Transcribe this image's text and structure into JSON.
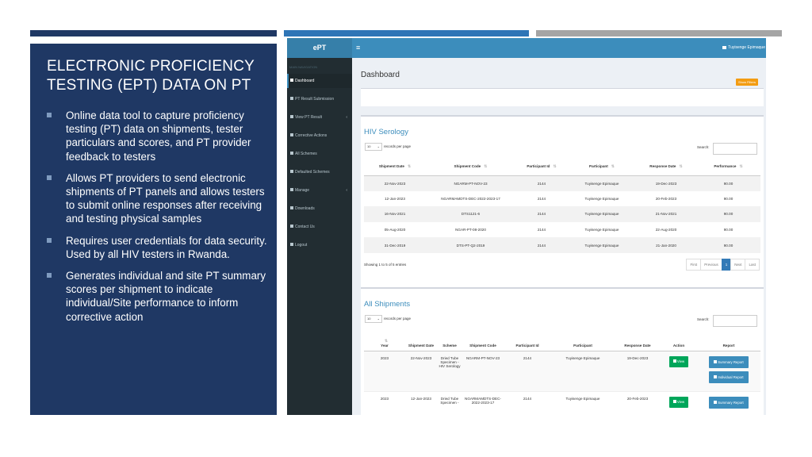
{
  "slide": {
    "title": "ELECTRONIC PROFICIENCY TESTING (EPT) DATA ON PT",
    "bullets": [
      "Online data tool to capture proficiency testing (PT) data on shipments, tester particulars and scores, and PT provider feedback to testers",
      "Allows PT providers to send electronic shipments of PT panels and allows testers to submit online responses after receiving and testing physical samples",
      "Requires user credentials for data security. Used by all HIV testers in Rwanda.",
      "Generates individual and site PT summary scores per shipment to indicate individual/Site performance to inform corrective action"
    ],
    "colors": {
      "panel": "#1f3864",
      "accent_bar": "#2e75b6",
      "gray_bar": "#a5a5a5"
    }
  },
  "app": {
    "brand": "ePT",
    "menu_glyph": "≡",
    "user": "Tuyisenge Epimaque",
    "nav_header": "MAIN NAVIGATION",
    "nav": [
      {
        "label": "Dashboard",
        "active": true
      },
      {
        "label": "PT Result Submission"
      },
      {
        "label": "View PT Result",
        "chevron": "‹"
      },
      {
        "label": "Corrective Actions"
      },
      {
        "label": "All Schemes"
      },
      {
        "label": "Defaulted Schemes"
      },
      {
        "label": "Manage",
        "chevron": "‹"
      },
      {
        "label": "Downloads"
      },
      {
        "label": "Contact Us"
      },
      {
        "label": "Logout"
      }
    ],
    "colors": {
      "header": "#3c8dbc",
      "sidebar": "#222d32",
      "show_filters": "#f39c12",
      "view_button": "#00a65a"
    }
  },
  "dashboard": {
    "title": "Dashboard",
    "show_filters": "Show Filters"
  },
  "serology": {
    "title": "HIV Serology",
    "page_length": "10",
    "records_label": "records per page",
    "search_label": "Search:",
    "headers": [
      "Shipment Date",
      "Shipment Code",
      "Participant Id",
      "Participant",
      "Response Date",
      "Performance"
    ],
    "rows": [
      [
        "22-Nov-2023",
        "NGARM-PT-NOV-23",
        "2144",
        "Tuyisenge Epimaque",
        "19-Dec-2023",
        "90.00"
      ],
      [
        "12-Jan-2023",
        "NGARMAMDTS-DEC-2022-2023-17",
        "2144",
        "Tuyisenge Epimaque",
        "20-Feb-2023",
        "90.00"
      ],
      [
        "16-Nov-2021",
        "DTS1121-6",
        "2144",
        "Tuyisenge Epimaque",
        "21-Nov-2021",
        "90.00"
      ],
      [
        "05-Aug-2020",
        "NGAR-PT-08-2020",
        "2144",
        "Tuyisenge Epimaque",
        "22-Aug-2020",
        "90.00"
      ],
      [
        "31-Dec-2019",
        "DTS-PT-Q2-2019",
        "2144",
        "Tuyisenge Epimaque",
        "21-Jan-2020",
        "90.00"
      ]
    ],
    "showing": "Showing 1 to 5 of 5 entries",
    "pager": {
      "first": "First",
      "previous": "Previous",
      "current": "1",
      "next": "Next",
      "last": "Last"
    }
  },
  "shipments": {
    "title": "All Shipments",
    "page_length": "10",
    "records_label": "records per page",
    "search_label": "Search:",
    "headers": {
      "year": "Year",
      "shipment_date": "Shipment Date",
      "scheme": "Scheme",
      "shipment_code": "Shipment Code",
      "participant_id": "Participant Id",
      "participant": "Participant",
      "response_date": "Response Date",
      "action": "Action",
      "report": "Report"
    },
    "rows": [
      {
        "year": "2023",
        "shipment_date": "22-Nov-2023",
        "scheme": "Dried Tube Specimen - HIV Serology",
        "shipment_code": "NGARM-PT-NOV-23",
        "participant_id": "2144",
        "participant": "Tuyisenge Epimaque",
        "response_date": "19-Dec-2023",
        "view": "View",
        "summary": "Summary Report",
        "individual": "Individual Report"
      },
      {
        "year": "2023",
        "shipment_date": "12-Jan-2023",
        "scheme": "Dried Tube Specimen -",
        "shipment_code": "NGARMAMDTS-DEC-2022-2023-17",
        "participant_id": "2144",
        "participant": "Tuyisenge Epimaque",
        "response_date": "20-Feb-2023",
        "view": "View",
        "summary": "Summary Report"
      }
    ]
  }
}
